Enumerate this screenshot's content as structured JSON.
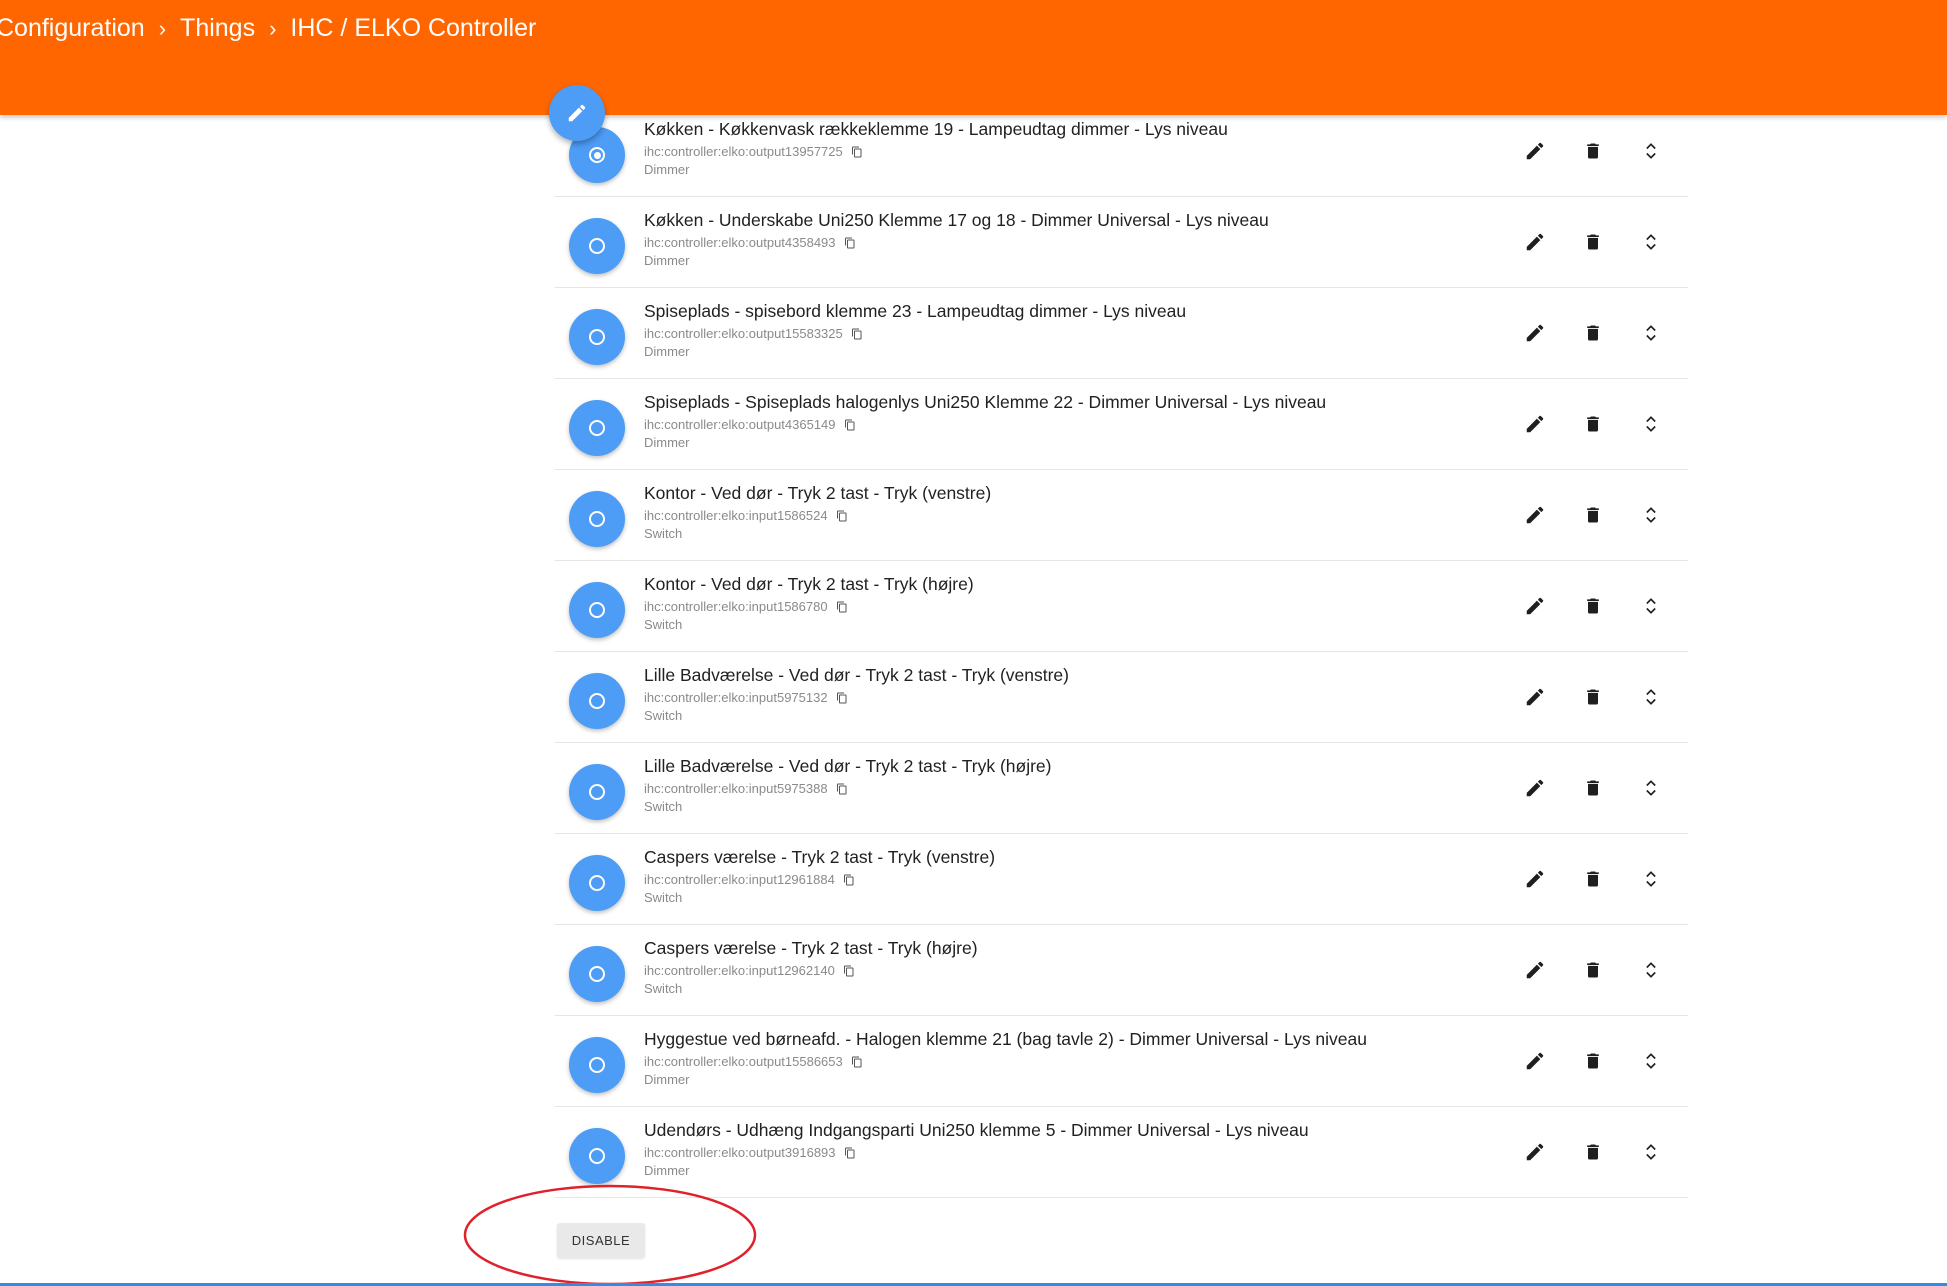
{
  "header": {
    "breadcrumb": [
      "Configuration",
      "Things",
      "IHC / ELKO Controller"
    ],
    "separator": "›",
    "background": "#ff6600"
  },
  "fab": {
    "icon": "pencil-icon",
    "color": "#4d9cf5"
  },
  "channels": [
    {
      "label": "Køkken - Køkkenvask rækkeklemme 19 - Lampeudtag dimmer - Lys niveau",
      "uid": "ihc:controller:elko:output13957725",
      "type": "Dimmer",
      "selected": true
    },
    {
      "label": "Køkken - Underskabe Uni250 Klemme 17 og 18 - Dimmer Universal - Lys niveau",
      "uid": "ihc:controller:elko:output4358493",
      "type": "Dimmer",
      "selected": false
    },
    {
      "label": "Spiseplads - spisebord klemme 23 - Lampeudtag dimmer - Lys niveau",
      "uid": "ihc:controller:elko:output15583325",
      "type": "Dimmer",
      "selected": false
    },
    {
      "label": "Spiseplads - Spiseplads halogenlys Uni250 Klemme 22 - Dimmer Universal - Lys niveau",
      "uid": "ihc:controller:elko:output4365149",
      "type": "Dimmer",
      "selected": false
    },
    {
      "label": "Kontor - Ved dør - Tryk 2 tast - Tryk (venstre)",
      "uid": "ihc:controller:elko:input1586524",
      "type": "Switch",
      "selected": false
    },
    {
      "label": "Kontor - Ved dør - Tryk 2 tast - Tryk (højre)",
      "uid": "ihc:controller:elko:input1586780",
      "type": "Switch",
      "selected": false
    },
    {
      "label": "Lille Badværelse - Ved dør - Tryk 2 tast - Tryk (venstre)",
      "uid": "ihc:controller:elko:input5975132",
      "type": "Switch",
      "selected": false
    },
    {
      "label": "Lille Badværelse - Ved dør - Tryk 2 tast - Tryk (højre)",
      "uid": "ihc:controller:elko:input5975388",
      "type": "Switch",
      "selected": false
    },
    {
      "label": "Caspers værelse - Tryk 2 tast - Tryk (venstre)",
      "uid": "ihc:controller:elko:input12961884",
      "type": "Switch",
      "selected": false
    },
    {
      "label": "Caspers værelse - Tryk 2 tast - Tryk (højre)",
      "uid": "ihc:controller:elko:input12962140",
      "type": "Switch",
      "selected": false
    },
    {
      "label": "Hyggestue ved børneafd. - Halogen klemme 21 (bag tavle 2) - Dimmer Universal - Lys niveau",
      "uid": "ihc:controller:elko:output15586653",
      "type": "Dimmer",
      "selected": false
    },
    {
      "label": "Udendørs - Udhæng Indgangsparti Uni250 klemme 5 - Dimmer Universal - Lys niveau",
      "uid": "ihc:controller:elko:output3916893",
      "type": "Dimmer",
      "selected": false
    }
  ],
  "row_actions": [
    "pencil-icon",
    "trash-icon",
    "unfold-icon"
  ],
  "footer": {
    "disable_label": "DISABLE",
    "annotation_color": "#e0202a"
  }
}
